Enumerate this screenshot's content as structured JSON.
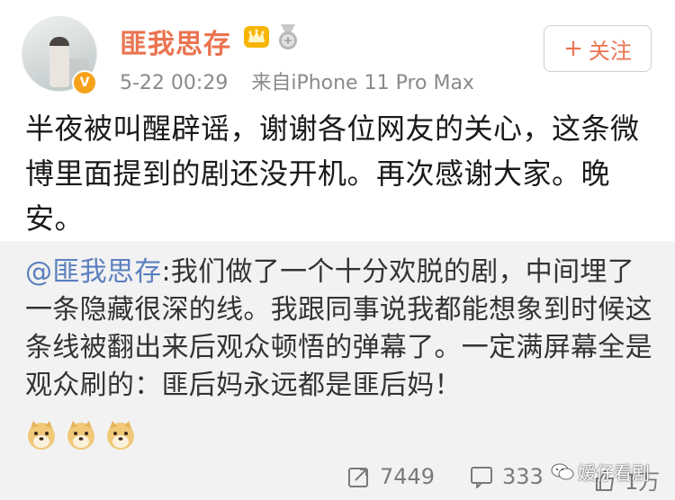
{
  "post": {
    "author": "匪我思存",
    "timestamp": "5-22 00:29",
    "source": "来自iPhone 11 Pro Max",
    "follow_label": "关注",
    "text": "半夜被叫醒辟谣，谢谢各位网友的关心，这条微博里面提到的剧还没开机。再次感谢大家。晚安。"
  },
  "repost": {
    "mention": "@匪我思存",
    "text": ":我们做了一个十分欢脱的剧，中间埋了一条隐藏很深的线。我跟同事说我都能想象到时候这条线被翻出来后观众顿悟的弹幕了。一定满屏幕全是观众刷的：匪后妈永远都是匪后妈！"
  },
  "actions": {
    "reposts": "7449",
    "comments": "333",
    "likes": "1万"
  },
  "watermark": "嫒仔看剧",
  "icons": {
    "crown": "crown-icon",
    "medal": "medal-icon",
    "verified": "verified-v-icon",
    "doge": "doge-icon",
    "repost": "repost-icon",
    "comment": "comment-icon",
    "like": "like-icon",
    "wechat": "wechat-icon"
  },
  "colors": {
    "username": "#eb7350",
    "mention": "#5b7fbf",
    "meta": "#8a8a8a",
    "repost_bg": "#f2f2f2"
  }
}
